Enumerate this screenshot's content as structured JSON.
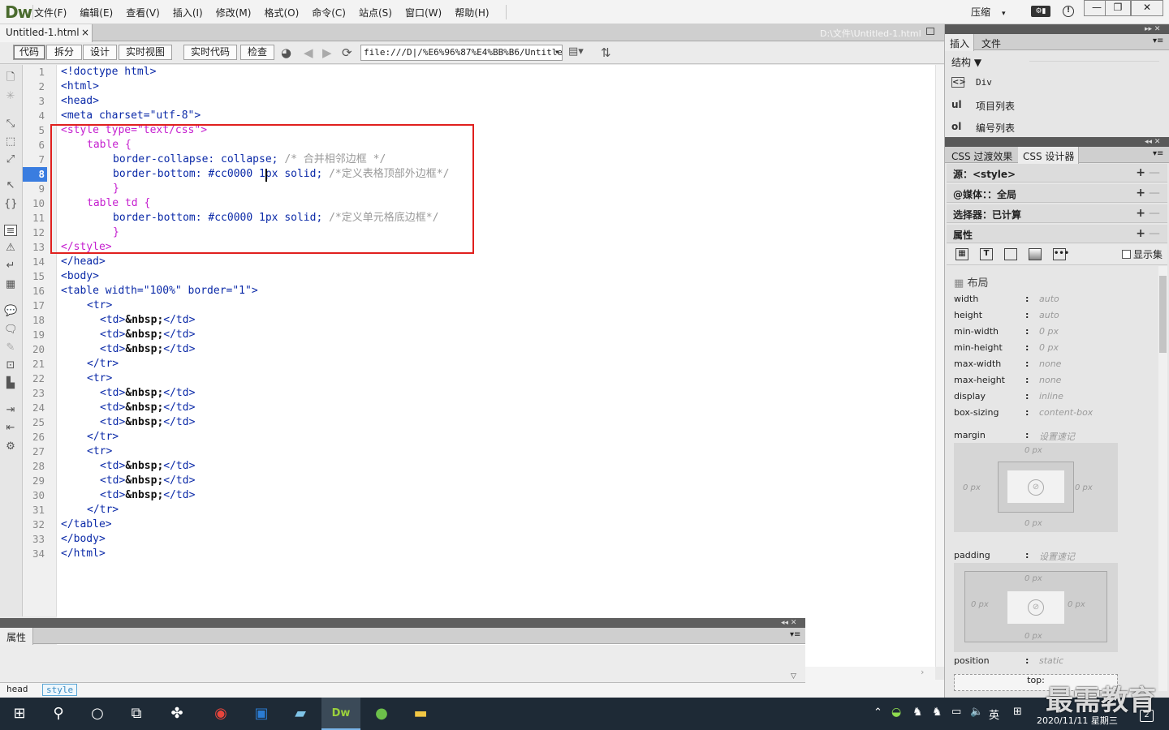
{
  "app": {
    "logo": "Dw"
  },
  "menu": [
    "文件(F)",
    "编辑(E)",
    "查看(V)",
    "插入(I)",
    "修改(M)",
    "格式(O)",
    "命令(C)",
    "站点(S)",
    "窗口(W)",
    "帮助(H)"
  ],
  "compress_label": "压缩",
  "window_controls": {
    "minimize": "—",
    "restore": "❐",
    "close": "✕"
  },
  "document": {
    "tab": "Untitled-1.html",
    "tab_close": "×",
    "path": "D:\\文件\\Untitled-1.html"
  },
  "toolbar": {
    "view_buttons": [
      "代码",
      "拆分",
      "设计",
      "实时视图"
    ],
    "live_code": "实时代码",
    "inspect": "检查",
    "address": "file:///D|/%E6%96%87%E4%BB%B6/Untitled"
  },
  "editor": {
    "active_line": 8,
    "line_numbers": [
      "1",
      "2",
      "3",
      "4",
      "5",
      "6",
      "7",
      "8",
      "9",
      "10",
      "11",
      "12",
      "13",
      "14",
      "15",
      "16",
      "17",
      "18",
      "19",
      "20",
      "21",
      "22",
      "23",
      "24",
      "25",
      "26",
      "27",
      "28",
      "29",
      "30",
      "31",
      "32",
      "33",
      "34"
    ],
    "code": {
      "l1": "<!doctype html>",
      "l2": "<html>",
      "l3": "<head>",
      "l4_tag": "<meta ",
      "l4_attr": "charset=",
      "l4_val": "\"utf-8\"",
      "l4_end": ">",
      "l5_tag": "<style ",
      "l5_attr": "type=",
      "l5_val": "\"text/css\"",
      "l5_end": ">",
      "l6": "table {",
      "l7_prop": "border-collapse: collapse;",
      "l7_cmt": "/* 合并相邻边框 */",
      "l8_prop": "border-bottom: #cc0000 1px solid;",
      "l8_cmt": "/*定义表格顶部外边框*/",
      "l9": "}",
      "l10": "table td {",
      "l11_prop": "border-bottom: #cc0000 1px solid;",
      "l11_cmt": "/*定义单元格底边框*/",
      "l12": "}",
      "l13": "</style>",
      "l14": "</head>",
      "l15": "<body>",
      "l16_tag": "<table ",
      "l16_a1": "width=",
      "l16_v1": "\"100%\"",
      "l16_a2": " border=",
      "l16_v2": "\"1\"",
      "l16_end": ">",
      "tr_open": "<tr>",
      "tr_close": "</tr>",
      "td_open": "<td>",
      "td_ent": "&nbsp;",
      "td_close": "</td>",
      "l32": "</table>",
      "l33": "</body>",
      "l34": "</html>"
    }
  },
  "properties_panel": {
    "tab": "属性"
  },
  "status_bar": {
    "crumbs": [
      "head",
      "style"
    ]
  },
  "right_panel": {
    "insert_tabs": [
      "插入",
      "文件"
    ],
    "structure_label": "结构",
    "insert_items": [
      {
        "icon": "<>",
        "label": "Div"
      },
      {
        "icon": "ul",
        "label": "项目列表"
      },
      {
        "icon": "ol",
        "label": "编号列表"
      }
    ],
    "css_tabs": [
      "CSS 过渡效果",
      "CSS 设计器"
    ],
    "sections": {
      "source": "源：<style>",
      "media": "@媒体：：全局",
      "selector": "选择器：已计算",
      "properties": "属性"
    },
    "show_set": "显示集",
    "layout_heading": "布局",
    "layout_props": [
      {
        "name": "width",
        "value": "auto"
      },
      {
        "name": "height",
        "value": "auto"
      },
      {
        "name": "min-width",
        "value": "0 px"
      },
      {
        "name": "min-height",
        "value": "0 px"
      },
      {
        "name": "max-width",
        "value": "none"
      },
      {
        "name": "max-height",
        "value": "none"
      },
      {
        "name": "display",
        "value": "inline"
      },
      {
        "name": "box-sizing",
        "value": "content-box"
      }
    ],
    "margin": {
      "label": "margin",
      "shorthand": "设置速记",
      "top": "0 px",
      "right": "0 px",
      "bottom": "0 px",
      "left": "0 px"
    },
    "padding": {
      "label": "padding",
      "shorthand": "设置速记",
      "top": "0 px",
      "right": "0 px",
      "bottom": "0 px",
      "left": "0 px"
    },
    "position": {
      "label": "position",
      "value": "static"
    },
    "top_label": "top:"
  },
  "taskbar": {
    "ime": "英",
    "clock_date": "2020/11/11 星期三",
    "notifications": "2"
  },
  "watermark": "最需教育"
}
